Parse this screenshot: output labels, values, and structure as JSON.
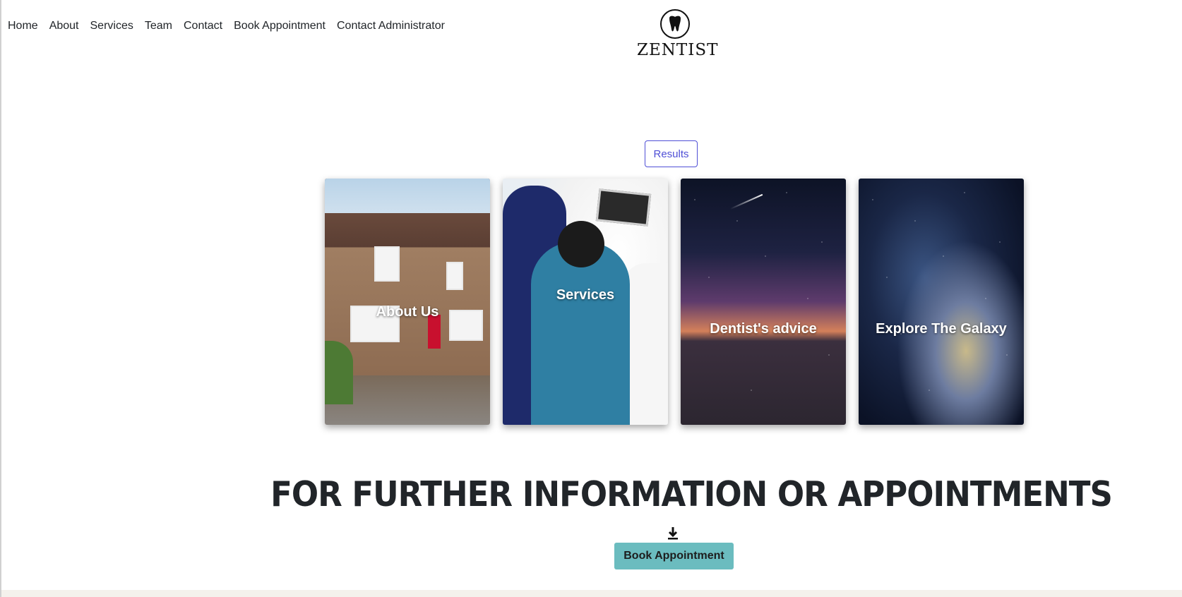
{
  "nav": {
    "items": [
      {
        "label": "Home"
      },
      {
        "label": "About"
      },
      {
        "label": "Services"
      },
      {
        "label": "Team"
      },
      {
        "label": "Contact"
      },
      {
        "label": "Book Appointment"
      },
      {
        "label": "Contact Administrator"
      }
    ]
  },
  "logo": {
    "icon": "tooth-icon",
    "brand": "ZENTIST"
  },
  "results_button": {
    "label": "Results",
    "color": "#4f4fd6"
  },
  "cards": [
    {
      "title": "About Us"
    },
    {
      "title": "Services"
    },
    {
      "title": "Dentist's advice"
    },
    {
      "title": "Explore The Galaxy"
    }
  ],
  "cta": {
    "heading": "FOR FURTHER INFORMATION OR APPOINTMENTS",
    "arrow_icon": "download-arrow-icon",
    "button_label": "Book Appointment",
    "button_color": "#6bbcbf"
  },
  "footer": {
    "background": "#f4f1ec"
  }
}
